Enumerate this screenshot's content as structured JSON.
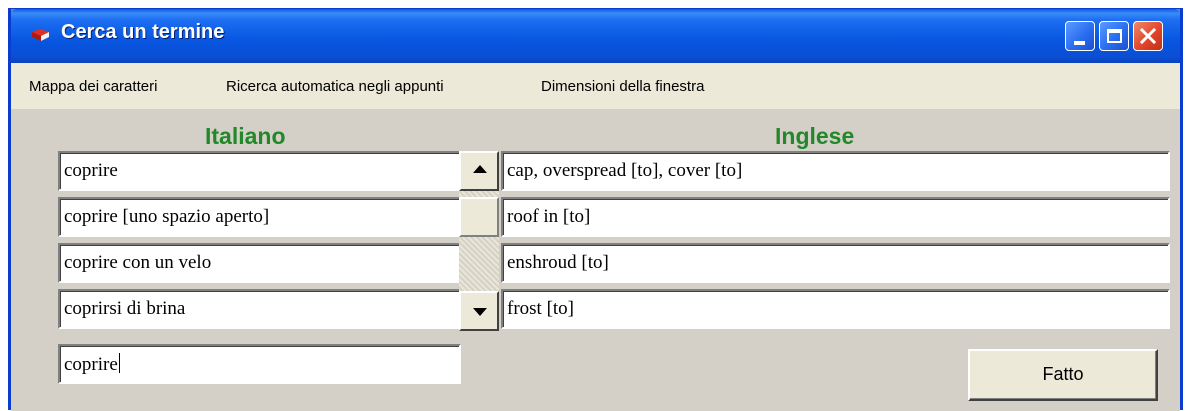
{
  "window": {
    "title": "Cerca un termine",
    "icon": "book-icon"
  },
  "menu": [
    "Mappa dei caratteri",
    "Ricerca automatica negli appunti",
    "Dimensioni della finestra"
  ],
  "columns": {
    "italian_heading": "Italiano",
    "english_heading": "Inglese"
  },
  "rows": [
    {
      "it": "coprire",
      "en": "cap, overspread [to], cover [to]"
    },
    {
      "it": "coprire [uno spazio aperto]",
      "en": "roof in [to]"
    },
    {
      "it": "coprire con un velo",
      "en": "enshroud [to]"
    },
    {
      "it": "coprirsi di brina",
      "en": "frost [to]"
    }
  ],
  "search": {
    "value": "coprire"
  },
  "done_button_label": "Fatto",
  "colors": {
    "heading_green": "#22882a",
    "titlebar_blue": "#0755e0",
    "dialog_gray": "#d4d0c8"
  }
}
